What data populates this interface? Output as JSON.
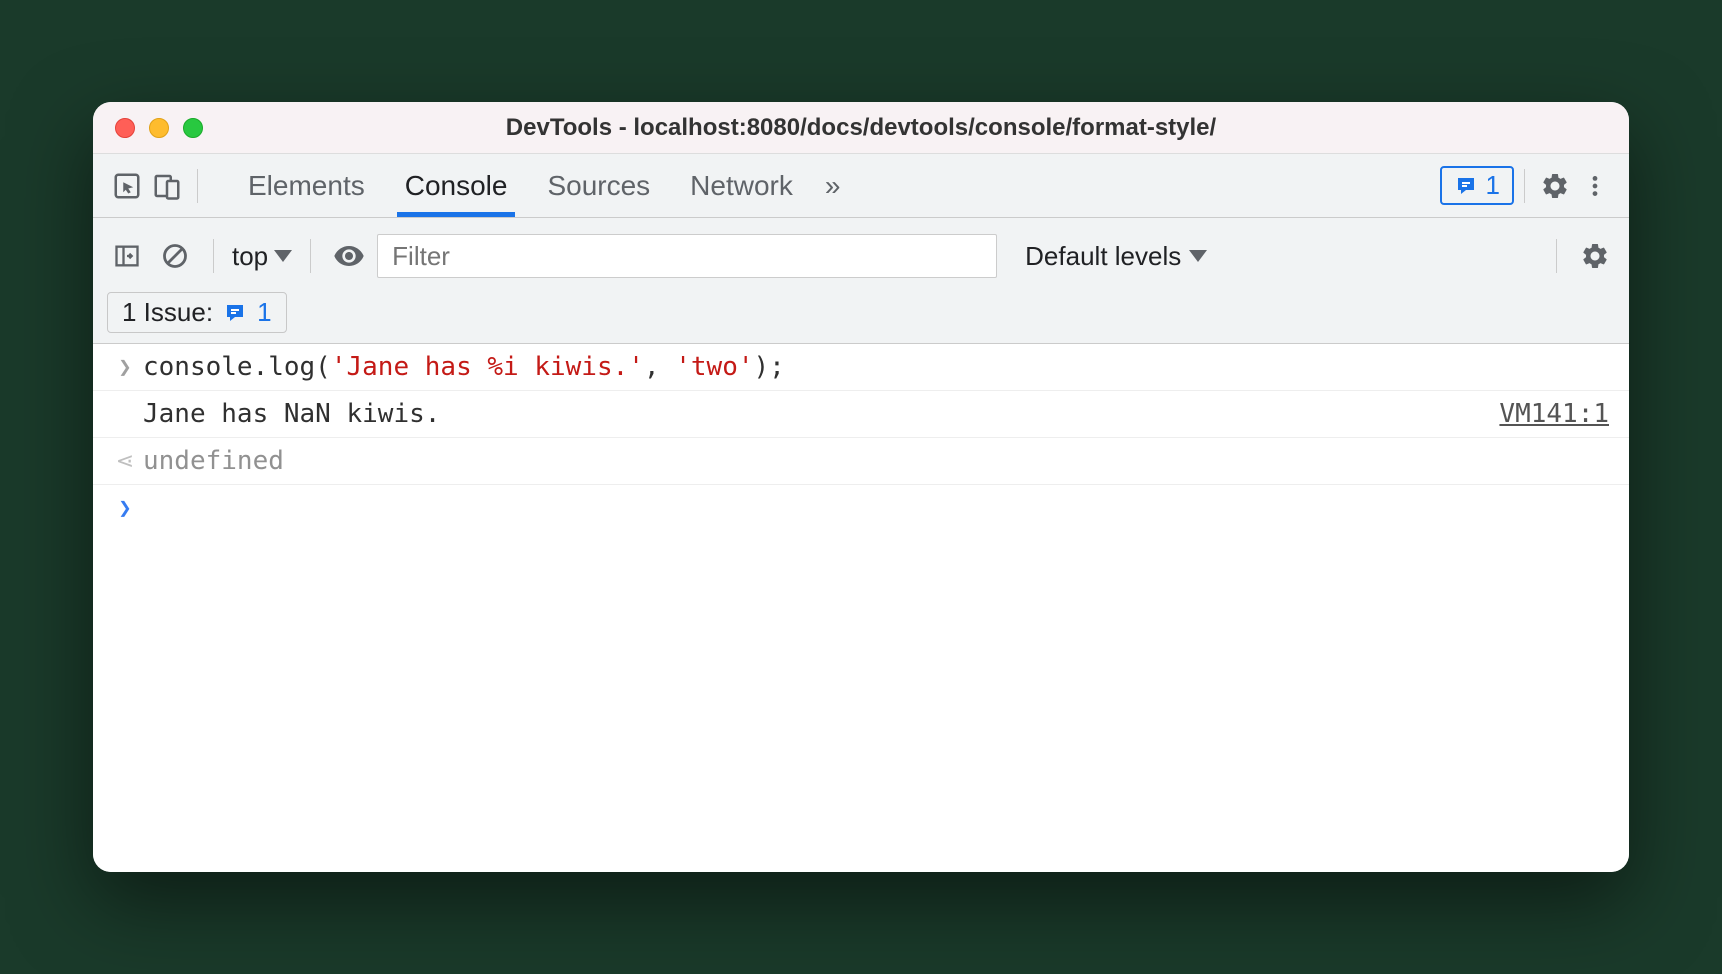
{
  "window": {
    "title": "DevTools - localhost:8080/docs/devtools/console/format-style/"
  },
  "tabs": {
    "elements": "Elements",
    "console": "Console",
    "sources": "Sources",
    "network": "Network",
    "more": "»"
  },
  "issues_badge_count": "1",
  "toolbar": {
    "context": "top",
    "filter_placeholder": "Filter",
    "levels": "Default levels"
  },
  "issue_pill": {
    "label": "1 Issue:",
    "count": "1"
  },
  "console": {
    "input_prefix": "console.log(",
    "input_str1": "'Jane has %i kiwis.'",
    "input_comma": ", ",
    "input_str2": "'two'",
    "input_suffix": ");",
    "output": "Jane has NaN kiwis.",
    "source": "VM141:1",
    "return": "undefined"
  }
}
